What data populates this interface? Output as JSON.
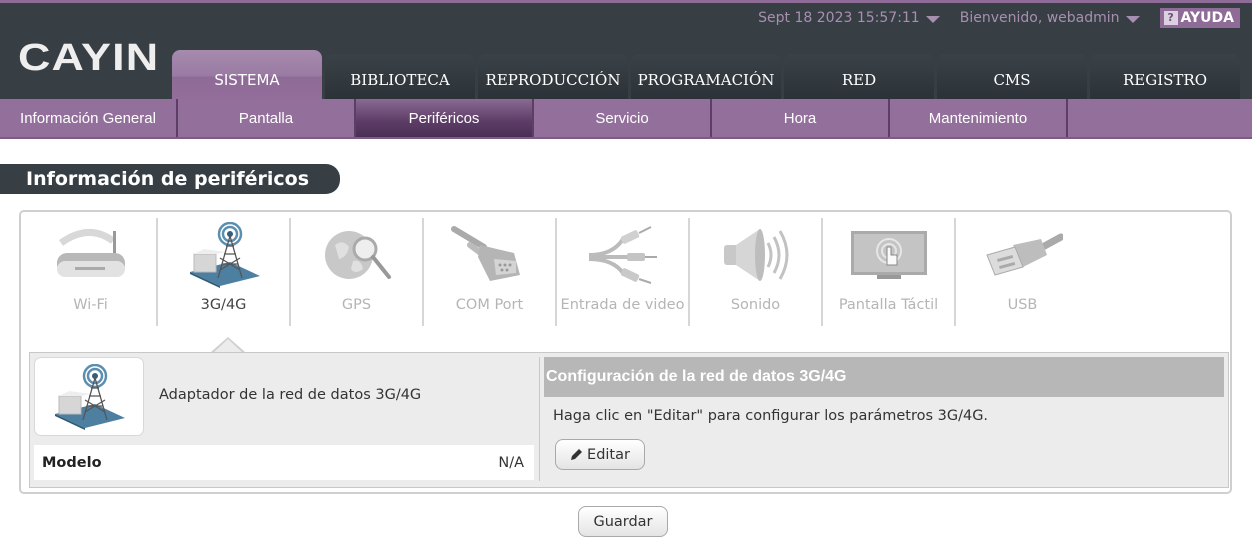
{
  "header": {
    "logo": "CAYIN",
    "datetime": "Sept 18 2023 15:57:11",
    "welcome": "Bienvenido, webadmin",
    "help_label": "AYUDA",
    "help_icon": "question-icon",
    "accent_color": "#8f6b97"
  },
  "main_tabs": [
    {
      "label": "SISTEMA",
      "active": true
    },
    {
      "label": "BIBLIOTECA",
      "active": false
    },
    {
      "label": "REPRODUCCIÓN",
      "active": false
    },
    {
      "label": "PROGRAMACIÓN",
      "active": false
    },
    {
      "label": "RED",
      "active": false
    },
    {
      "label": "CMS",
      "active": false
    },
    {
      "label": "REGISTRO",
      "active": false
    }
  ],
  "sub_tabs": [
    {
      "label": "Información General",
      "active": false
    },
    {
      "label": "Pantalla",
      "active": false
    },
    {
      "label": "Periféricos",
      "active": true
    },
    {
      "label": "Servicio",
      "active": false
    },
    {
      "label": "Hora",
      "active": false
    },
    {
      "label": "Mantenimiento",
      "active": false
    }
  ],
  "page_title": "Información de periféricos",
  "devices": [
    {
      "label": "Wi-Fi",
      "icon": "wifi-router-icon",
      "active": false
    },
    {
      "label": "3G/4G",
      "icon": "cell-tower-icon",
      "active": true
    },
    {
      "label": "GPS",
      "icon": "globe-search-icon",
      "active": false
    },
    {
      "label": "COM Port",
      "icon": "serial-connector-icon",
      "active": false
    },
    {
      "label": "Entrada de video",
      "icon": "rca-cable-icon",
      "active": false
    },
    {
      "label": "Sonido",
      "icon": "speaker-icon",
      "active": false
    },
    {
      "label": "Pantalla Táctil",
      "icon": "touch-screen-icon",
      "active": false
    },
    {
      "label": "USB",
      "icon": "usb-plug-icon",
      "active": false
    }
  ],
  "detail": {
    "adapter_name": "Adaptador de la red de datos 3G/4G",
    "model_label": "Modelo",
    "model_value": "N/A",
    "config_title": "Configuración de la red de datos 3G/4G",
    "config_text": "Haga clic en \"Editar\" para configurar los parámetros 3G/4G.",
    "edit_label": "Editar",
    "edit_icon": "pencil-icon"
  },
  "save_label": "Guardar"
}
